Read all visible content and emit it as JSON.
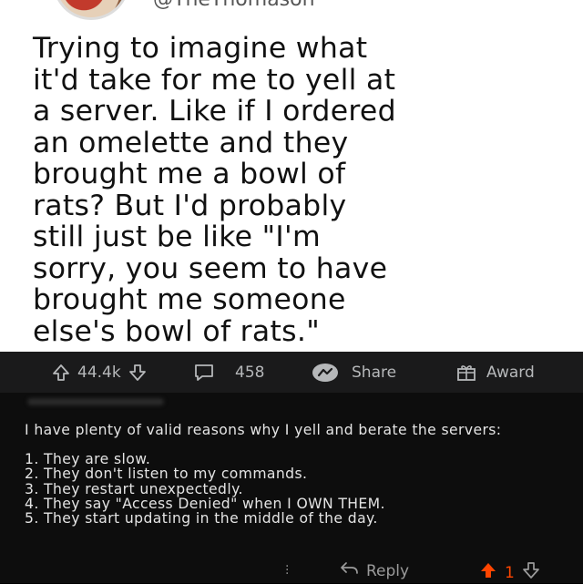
{
  "tweet": {
    "handle": "@TheThomason",
    "text": "Trying to imagine what\nit'd take for me to yell at\na server. Like if I ordered\nan omelette and they\nbrought me a bowl of\nrats? But I'd probably\nstill just be like \"I'm\nsorry, you seem to have\nbrought me someone\nelse's bowl of rats.\""
  },
  "actions": {
    "upvotes": "44.4k",
    "comments": "458",
    "share_label": "Share",
    "award_label": "Award"
  },
  "comment": {
    "intro": "I have plenty of valid reasons why I yell and berate the servers:",
    "items": [
      "1. They are slow.",
      "2. They don't listen to my commands.",
      "3. They restart unexpectedly.",
      "4. They say \"Access Denied\" when I OWN THEM.",
      "5. They start updating in the middle of the day."
    ],
    "reply_label": "Reply",
    "score": "1"
  },
  "colors": {
    "upvote": "#ff4500",
    "bar": "#1a1a1b",
    "comment_bg": "#0d0d0d"
  }
}
